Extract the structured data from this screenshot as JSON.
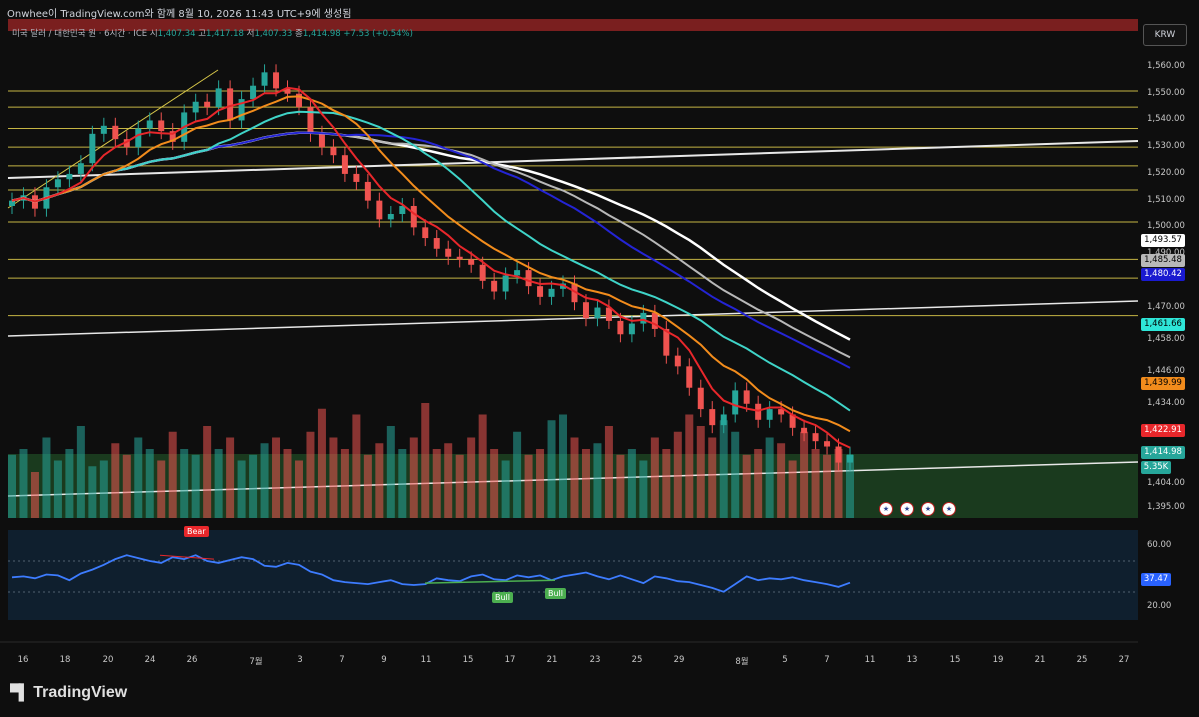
{
  "header": {
    "title": "Onwhee이 TradingView.com와 함께 8월 10, 2026 11:43 UTC+9에 생성됨"
  },
  "symbol": {
    "name": "미국 달러 / 대한민국 원 · 6시간 · ICE",
    "open_label": "시",
    "open": "1,407.34",
    "high_label": "고",
    "high": "1,417.18",
    "low_label": "저",
    "low": "1,407.33",
    "close_label": "종",
    "close": "1,414.98",
    "change": "+7.53 (+0.54%)"
  },
  "currency_button": "KRW",
  "brand": "TradingView",
  "colors": {
    "up": "#26a69a",
    "down": "#ef5350",
    "ma_red": "#e8272b",
    "ma_orange": "#f28c1c",
    "ma_cyan": "#3fd4c8",
    "ma_blue": "#2424d4",
    "ma_grey": "#b8b8b8",
    "ma_white": "#ffffff",
    "level_lines": "#d9c84a",
    "rsi": "#3d7cff"
  },
  "chart_data": {
    "type": "candlestick",
    "price_axis": [
      "1,560.00",
      "1,550.00",
      "1,540.00",
      "1,530.00",
      "1,520.00",
      "1,510.00",
      "1,500.00",
      "1,490.00",
      "1,470.00",
      "1,458.00",
      "1,446.00",
      "1,434.00",
      "1,404.00",
      "1,395.00"
    ],
    "price_labels": [
      {
        "value": "1,493.57",
        "bg": "#ffffff",
        "fg": "#000000"
      },
      {
        "value": "1,485.48",
        "bg": "#b8b8b8",
        "fg": "#000000"
      },
      {
        "value": "1,480.42",
        "bg": "#1a1ad0",
        "fg": "#ffffff"
      },
      {
        "value": "1,461.66",
        "bg": "#2ee6d8",
        "fg": "#000000"
      },
      {
        "value": "1,439.99",
        "bg": "#f28c1c",
        "fg": "#000000"
      },
      {
        "value": "1,422.91",
        "bg": "#e8272b",
        "fg": "#ffffff"
      },
      {
        "value": "1,414.98",
        "bg": "#26a69a",
        "fg": "#ffffff"
      },
      {
        "value": "5.35K",
        "bg": "#26a69a",
        "fg": "#ffffff"
      }
    ],
    "time_axis": [
      "16",
      "18",
      "20",
      "24",
      "26",
      "7월",
      "3",
      "7",
      "9",
      "11",
      "15",
      "17",
      "21",
      "23",
      "25",
      "29",
      "8월",
      "5",
      "7",
      "11",
      "13",
      "15",
      "19",
      "21",
      "25",
      "27"
    ],
    "horizontal_levels": [
      1551,
      1545,
      1537,
      1530,
      1523,
      1514,
      1502,
      1488,
      1481,
      1467
    ],
    "close_series": [
      1510,
      1512,
      1507,
      1515,
      1518,
      1520,
      1524,
      1535,
      1538,
      1533,
      1530,
      1537,
      1540,
      1536,
      1532,
      1543,
      1547,
      1545,
      1552,
      1540,
      1548,
      1553,
      1558,
      1552,
      1550,
      1545,
      1535,
      1530,
      1527,
      1520,
      1517,
      1510,
      1503,
      1505,
      1508,
      1500,
      1496,
      1492,
      1489,
      1488,
      1486,
      1480,
      1476,
      1482,
      1484,
      1478,
      1474,
      1477,
      1479,
      1472,
      1466,
      1470,
      1465,
      1460,
      1464,
      1468,
      1462,
      1452,
      1448,
      1440,
      1432,
      1426,
      1430,
      1439,
      1434,
      1428,
      1432,
      1430,
      1425,
      1423,
      1420,
      1418,
      1412,
      1414.98
    ],
    "volume_series": [
      0.55,
      0.6,
      0.4,
      0.7,
      0.5,
      0.6,
      0.8,
      0.45,
      0.5,
      0.65,
      0.55,
      0.7,
      0.6,
      0.5,
      0.75,
      0.6,
      0.55,
      0.8,
      0.6,
      0.7,
      0.5,
      0.55,
      0.65,
      0.7,
      0.6,
      0.5,
      0.75,
      0.95,
      0.7,
      0.6,
      0.9,
      0.55,
      0.65,
      0.8,
      0.6,
      0.7,
      1.0,
      0.6,
      0.65,
      0.55,
      0.7,
      0.9,
      0.6,
      0.5,
      0.75,
      0.55,
      0.6,
      0.85,
      0.9,
      0.7,
      0.6,
      0.65,
      0.8,
      0.55,
      0.6,
      0.5,
      0.7,
      0.6,
      0.75,
      0.9,
      0.8,
      0.7,
      0.85,
      0.75,
      0.55,
      0.6,
      0.7,
      0.65,
      0.5,
      0.75,
      0.6,
      0.55,
      0.6,
      0.55
    ],
    "rsi": {
      "axis": [
        "60.00",
        "37.47",
        "20.00"
      ],
      "current": "37.47",
      "values": [
        43,
        44,
        42,
        46,
        45,
        40,
        47,
        51,
        56,
        62,
        66,
        63,
        60,
        58,
        64,
        62,
        66,
        60,
        58,
        61,
        64,
        62,
        55,
        54,
        58,
        56,
        49,
        46,
        40,
        38,
        37,
        36,
        38,
        40,
        36,
        35,
        36,
        42,
        40,
        39,
        44,
        46,
        41,
        40,
        45,
        43,
        45,
        40,
        44,
        46,
        48,
        44,
        41,
        45,
        41,
        37,
        44,
        42,
        39,
        38,
        35,
        32,
        28,
        36,
        44,
        40,
        42,
        41,
        43,
        40,
        38,
        36,
        33,
        37.47
      ]
    },
    "markers": [
      {
        "label": "Bear"
      },
      {
        "label": "Bull"
      },
      {
        "label": "Bull"
      }
    ]
  }
}
